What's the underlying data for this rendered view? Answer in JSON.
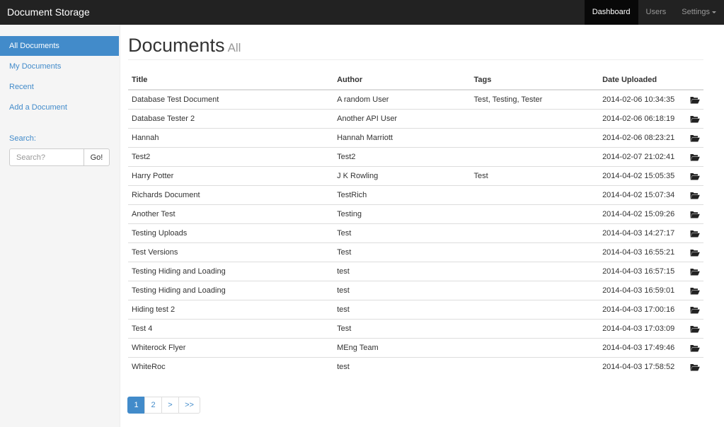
{
  "navbar": {
    "brand": "Document Storage",
    "items": [
      {
        "label": "Dashboard",
        "active": true
      },
      {
        "label": "Users",
        "active": false
      },
      {
        "label": "Settings",
        "active": false
      }
    ]
  },
  "sidebar": {
    "links": [
      {
        "label": "All Documents",
        "active": true
      },
      {
        "label": "My Documents",
        "active": false
      },
      {
        "label": "Recent",
        "active": false
      },
      {
        "label": "Add a Document",
        "active": false
      }
    ],
    "search": {
      "label": "Search:",
      "placeholder": "Search?",
      "button_label": "Go!"
    }
  },
  "main": {
    "title": "Documents",
    "subtitle": "All",
    "table": {
      "headers": [
        "Title",
        "Author",
        "Tags",
        "Date Uploaded"
      ],
      "rows": [
        {
          "title": "Database Test Document",
          "author": "A random User",
          "tags": "Test, Testing, Tester",
          "date": "2014-02-06 10:34:35"
        },
        {
          "title": "Database Tester 2",
          "author": "Another API User",
          "tags": "",
          "date": "2014-02-06 06:18:19"
        },
        {
          "title": "Hannah",
          "author": "Hannah Marriott",
          "tags": "",
          "date": "2014-02-06 08:23:21"
        },
        {
          "title": "Test2",
          "author": "Test2",
          "tags": "",
          "date": "2014-02-07 21:02:41"
        },
        {
          "title": "Harry Potter",
          "author": "J K Rowling",
          "tags": "Test",
          "date": "2014-04-02 15:05:35"
        },
        {
          "title": "Richards Document",
          "author": "TestRich",
          "tags": "",
          "date": "2014-04-02 15:07:34"
        },
        {
          "title": "Another Test",
          "author": "Testing",
          "tags": "",
          "date": "2014-04-02 15:09:26"
        },
        {
          "title": "Testing Uploads",
          "author": "Test",
          "tags": "",
          "date": "2014-04-03 14:27:17"
        },
        {
          "title": "Test Versions",
          "author": "Test",
          "tags": "",
          "date": "2014-04-03 16:55:21"
        },
        {
          "title": "Testing Hiding and Loading",
          "author": "test",
          "tags": "",
          "date": "2014-04-03 16:57:15"
        },
        {
          "title": "Testing Hiding and Loading",
          "author": "test",
          "tags": "",
          "date": "2014-04-03 16:59:01"
        },
        {
          "title": "Hiding test 2",
          "author": "test",
          "tags": "",
          "date": "2014-04-03 17:00:16"
        },
        {
          "title": "Test 4",
          "author": "Test",
          "tags": "",
          "date": "2014-04-03 17:03:09"
        },
        {
          "title": "Whiterock Flyer",
          "author": "MEng Team",
          "tags": "",
          "date": "2014-04-03 17:49:46"
        },
        {
          "title": "WhiteRoc",
          "author": "test",
          "tags": "",
          "date": "2014-04-03 17:58:52"
        }
      ],
      "row_icon": "folder-open-icon"
    },
    "pagination": [
      {
        "label": "1",
        "active": true
      },
      {
        "label": "2",
        "active": false
      },
      {
        "label": ">",
        "active": false
      },
      {
        "label": ">>",
        "active": false
      }
    ]
  },
  "colors": {
    "navbar_bg": "#222222",
    "accent": "#428bca",
    "sidebar_bg": "#f5f5f5"
  }
}
